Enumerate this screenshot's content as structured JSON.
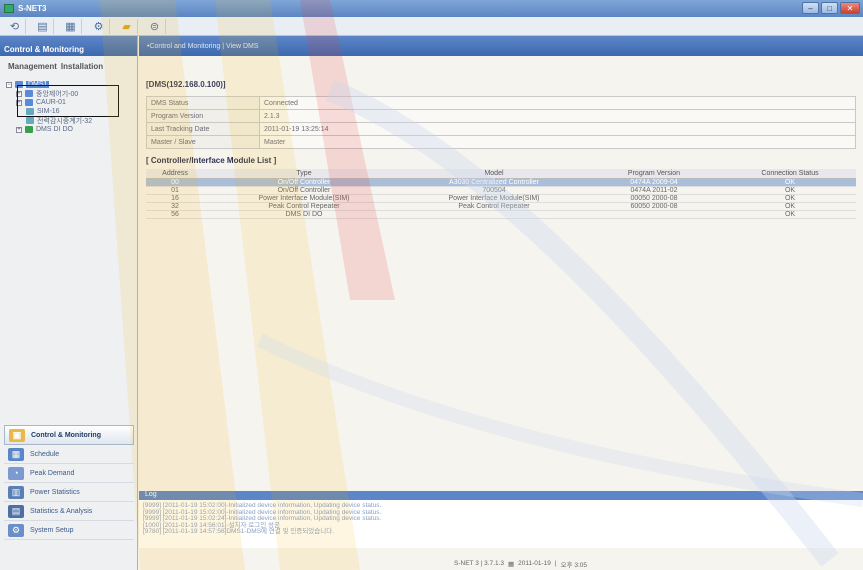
{
  "window": {
    "title": "S-NET3"
  },
  "toolbar": {
    "icons": [
      "back-icon",
      "monitor-icon",
      "chart-icon",
      "settings-icon",
      "folder-icon",
      "help-icon"
    ]
  },
  "left_panel": {
    "header": "Control & Monitoring",
    "tabs": [
      "Management",
      "Installation"
    ],
    "tree": [
      {
        "label": "DMS1",
        "level": 0
      },
      {
        "label": "중앙제어기-00",
        "level": 1
      },
      {
        "label": "CAUR-01",
        "level": 1
      },
      {
        "label": "SIM-16",
        "level": 2
      },
      {
        "label": "전력감시중계기-32",
        "level": 1
      },
      {
        "label": "DMS DI DO",
        "level": 1
      }
    ],
    "nav": [
      {
        "label": "Control & Monitoring",
        "icon": "monitor-icon",
        "active": true
      },
      {
        "label": "Schedule",
        "icon": "calendar-icon",
        "active": false
      },
      {
        "label": "Peak Demand",
        "icon": "peak-icon",
        "active": false
      },
      {
        "label": "Power Statistics",
        "icon": "power-icon",
        "active": false
      },
      {
        "label": "Statistics & Analysis",
        "icon": "analysis-icon",
        "active": false
      },
      {
        "label": "System Setup",
        "icon": "setup-icon",
        "active": false
      }
    ]
  },
  "main": {
    "breadcrumb": "•Control and Monitoring | View DMS",
    "dms_title": "[DMS(192.168.0.100)]",
    "status": [
      {
        "key": "DMS Status",
        "value": "Connected"
      },
      {
        "key": "Program Version",
        "value": "2.1.3"
      },
      {
        "key": "Last Tracking Date",
        "value": "2011-01-19  13:25:14"
      },
      {
        "key": "Master / Slave",
        "value": "Master"
      }
    ],
    "module_list_title": "[ Controller/Interface Module List ]",
    "module_headers": [
      "Address",
      "Type",
      "Model",
      "Program Version",
      "Connection Status"
    ],
    "modules": [
      [
        "00",
        "On/Off Controller",
        "A3030 Centralized Controller",
        "0474A 2009-04",
        "OK"
      ],
      [
        "01",
        "On/Off Controller",
        "700504",
        "0474A 2011-02",
        "OK"
      ],
      [
        "16",
        "Power Interface Module(SIM)",
        "Power Interface Module(SIM)",
        "00050 2000-08",
        "OK"
      ],
      [
        "32",
        "Peak Control Repeater",
        "Peak Control Repeater",
        "60050 2000-08",
        "OK"
      ],
      [
        "56",
        "DMS DI DO",
        "",
        "",
        "OK"
      ]
    ]
  },
  "log": {
    "title": "Log",
    "lines": [
      "[9999] [2011-01-19 15:02:00]-Initialized device information, Updating device status.",
      "[9999] [2011-01-19 15:02:00]-Initialized device information, Updating device status.",
      "[9999] [2011-01-19 15:02:24]-Initialized device information, Updating device status.",
      "[1000] [2011-01-19 14:56:01]-설치자 로그인 성공",
      "[9780] [2011-01-19 14:57:56]DMS1-DMS에 연결 및 인증되었습니다."
    ]
  },
  "statusbar": {
    "version": "S-NET 3 | 3.7.1.3",
    "date": "2011-01-19",
    "time": "오후 3:05"
  }
}
